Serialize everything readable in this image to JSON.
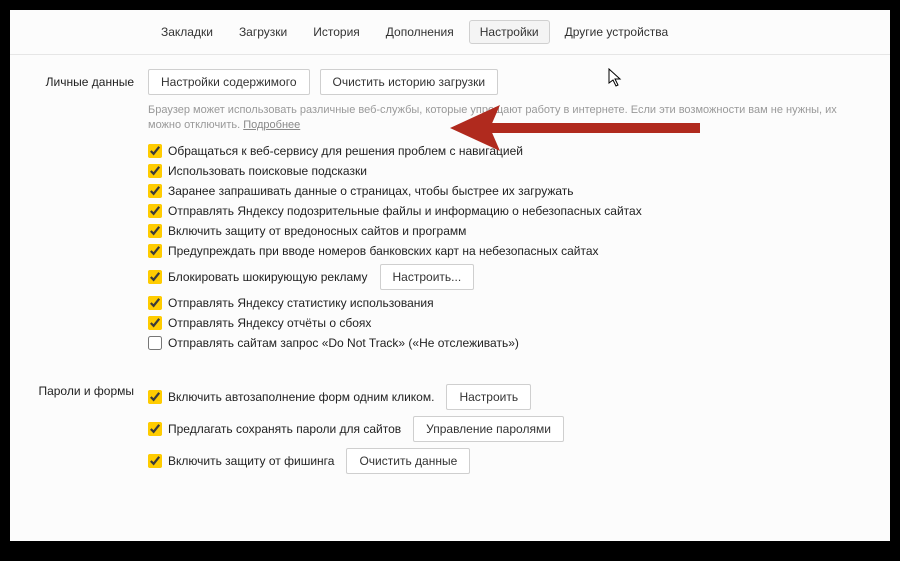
{
  "nav": {
    "bookmarks": "Закладки",
    "downloads": "Загрузки",
    "history": "История",
    "addons": "Дополнения",
    "settings": "Настройки",
    "devices": "Другие устройства"
  },
  "personal": {
    "title": "Личные данные",
    "content_settings_btn": "Настройки содержимого",
    "clear_history_btn": "Очистить историю загрузки",
    "hint_text": "Браузер может использовать различные веб-службы, которые упрощают работу в интернете. Если эти возможности вам не нужны, их можно отключить. ",
    "hint_more": "Подробнее",
    "opts": [
      {
        "checked": true,
        "label": "Обращаться к веб-сервису для решения проблем с навигацией"
      },
      {
        "checked": true,
        "label": "Использовать поисковые подсказки"
      },
      {
        "checked": true,
        "label": "Заранее запрашивать данные о страницах, чтобы быстрее их загружать"
      },
      {
        "checked": true,
        "label": "Отправлять Яндексу подозрительные файлы и информацию о небезопасных сайтах"
      },
      {
        "checked": true,
        "label": "Включить защиту от вредоносных сайтов и программ"
      },
      {
        "checked": true,
        "label": "Предупреждать при вводе номеров банковских карт на небезопасных сайтах"
      },
      {
        "checked": true,
        "label": "Блокировать шокирующую рекламу",
        "btn": "Настроить..."
      },
      {
        "checked": true,
        "label": "Отправлять Яндексу статистику использования"
      },
      {
        "checked": true,
        "label": "Отправлять Яндексу отчёты о сбоях"
      },
      {
        "checked": false,
        "label": "Отправлять сайтам запрос «Do Not Track» («Не отслеживать»)"
      }
    ]
  },
  "passwords": {
    "title": "Пароли и формы",
    "opts": [
      {
        "checked": true,
        "label": "Включить автозаполнение форм одним кликом.",
        "btn": "Настроить"
      },
      {
        "checked": true,
        "label": "Предлагать сохранять пароли для сайтов",
        "btn": "Управление паролями"
      },
      {
        "checked": true,
        "label": "Включить защиту от фишинга",
        "btn": "Очистить данные"
      }
    ]
  }
}
